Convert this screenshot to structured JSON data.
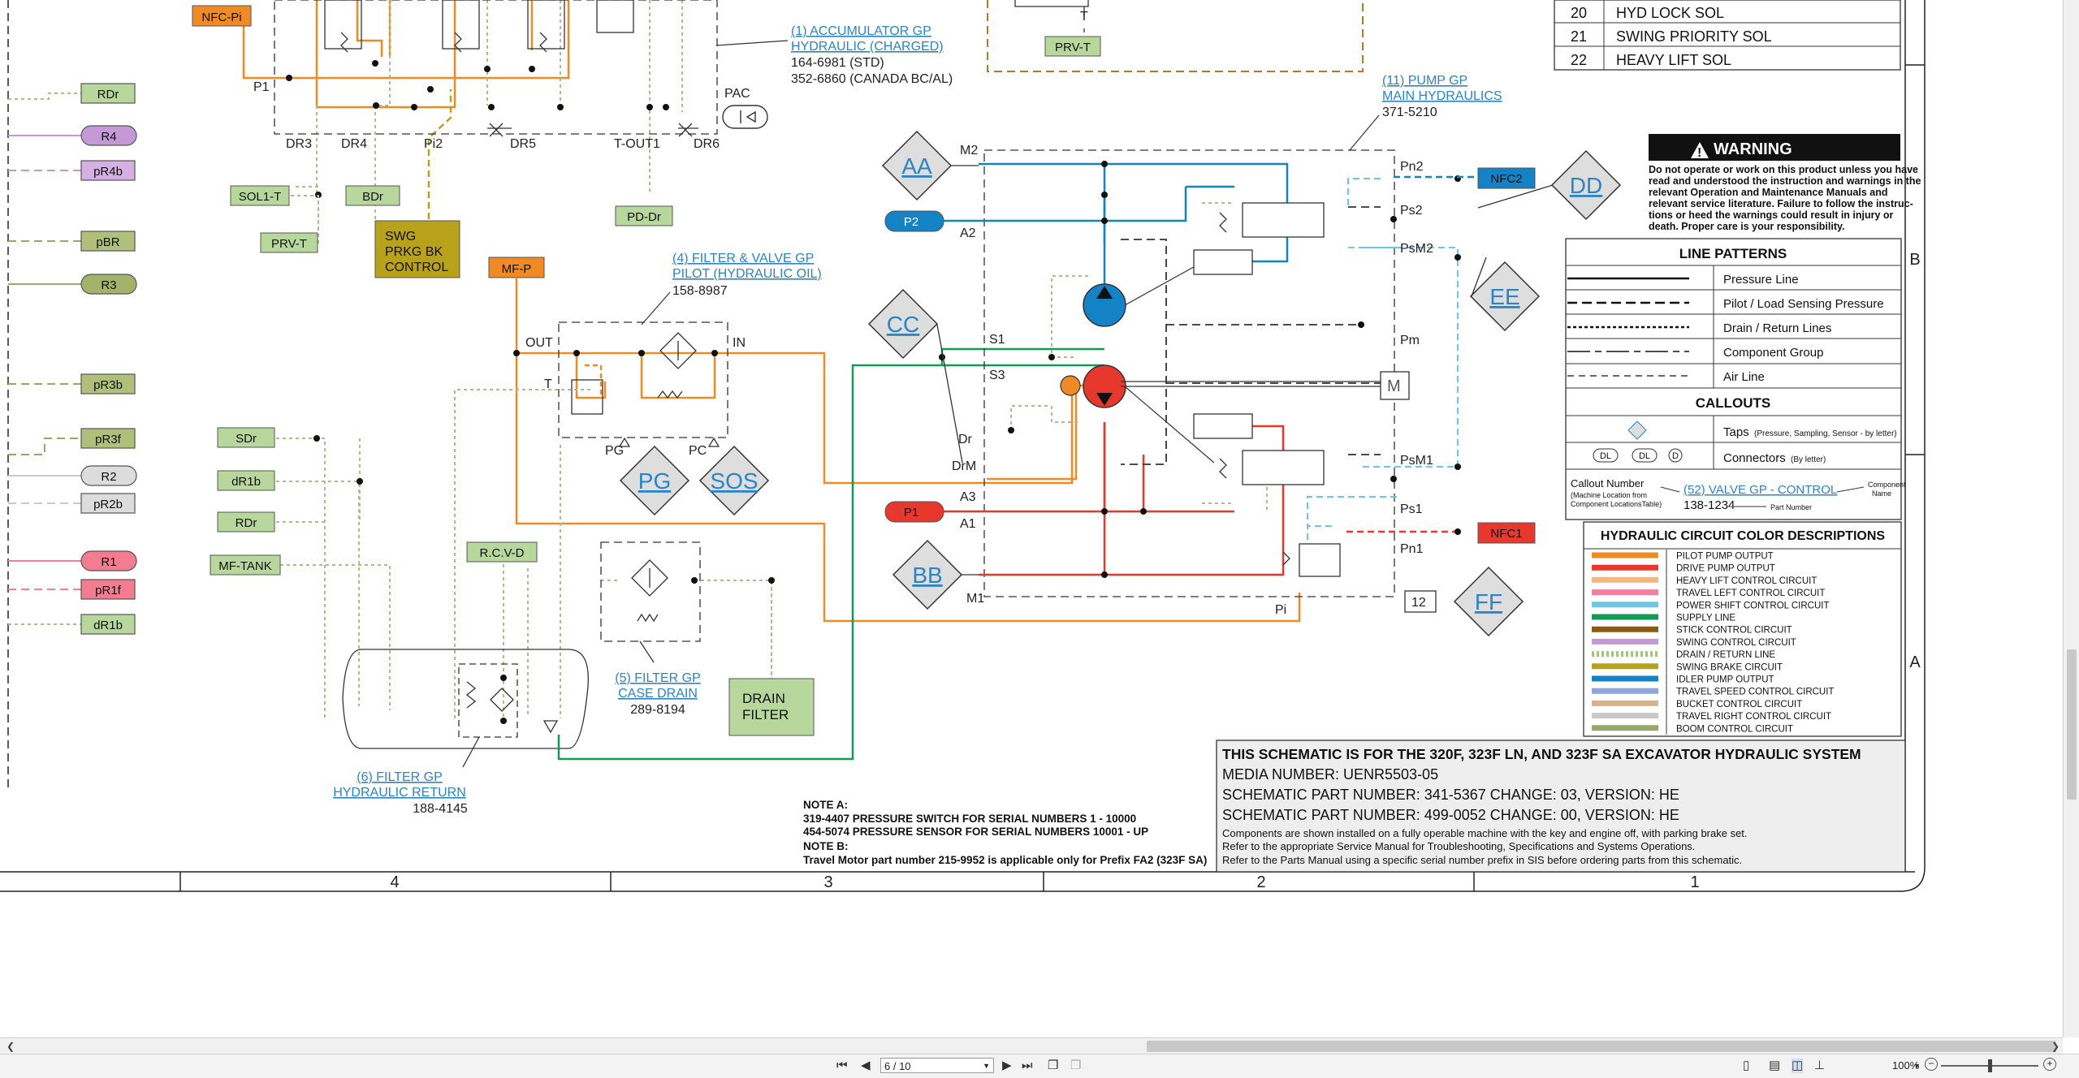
{
  "schematic": {
    "tags_left": [
      "RDr",
      "R4",
      "pR4b",
      "pBR",
      "R3",
      "pR3b",
      "pR3f",
      "R2",
      "pR2b",
      "R1",
      "pR1f",
      "dR1b"
    ],
    "tag_nfc_pi": "NFC-Pi",
    "tag_sol1t": "SOL1-T",
    "tag_bdr": "BDr",
    "tag_prvt": "PRV-T",
    "tag_prvt_top": "PRV-T",
    "tag_pddr": "PD-Dr",
    "tag_mfp": "MF-P",
    "tag_sdr": "SDr",
    "tag_dr1b": "dR1b",
    "tag_rdr2": "RDr",
    "tag_mftank": "MF-TANK",
    "tag_rcvd": "R.C.V-D",
    "tag_p2": "P2",
    "tag_p1": "P1",
    "tag_nfc2": "NFC2",
    "tag_nfc1": "NFC1",
    "swg_block": [
      "SWG",
      "PRKG BK",
      "CONTROL"
    ],
    "drain_filter": [
      "DRAIN",
      "FILTER"
    ],
    "valve_labels": [
      "P1",
      "DR3",
      "DR4",
      "Pi2",
      "DR5",
      "T-OUT1",
      "DR6",
      "PAC"
    ],
    "filter_labels": [
      "OUT",
      "IN",
      "T",
      "PG",
      "PC"
    ],
    "pump_labels": [
      "M2",
      "A2",
      "S1",
      "S3",
      "Dr",
      "DrM",
      "A3",
      "A1",
      "M1",
      "Pn2",
      "Ps2",
      "PsM2",
      "Pm",
      "PsM1",
      "Ps1",
      "Pn1",
      "Pi",
      "12"
    ],
    "diamonds": [
      "AA",
      "CC",
      "PG",
      "SOS",
      "BB",
      "DD",
      "EE",
      "FF"
    ],
    "callout_accum": [
      "(1) ACCUMULATOR GP",
      "HYDRAULIC (CHARGED)",
      "164-6981 (STD)",
      "352-6860 (CANADA BC/AL)"
    ],
    "callout_pump": [
      "(11) PUMP GP",
      "MAIN HYDRAULICS",
      "371-5210"
    ],
    "callout_filter4": [
      "(4) FILTER & VALVE GP",
      "PILOT (HYDRAULIC OIL)",
      "158-8987"
    ],
    "callout_filter5": [
      "(5) FILTER GP",
      "CASE DRAIN",
      "289-8194"
    ],
    "callout_filter6": [
      "(6) FILTER GP",
      "HYDRAULIC RETURN",
      "188-4145"
    ],
    "table_rows": [
      [
        "20",
        "HYD LOCK SOL"
      ],
      [
        "21",
        "SWING PRIORITY SOL"
      ],
      [
        "22",
        "HEAVY LIFT SOL"
      ]
    ],
    "warning_title": "WARNING",
    "warning_text": [
      "Do not operate or work on this product unless you have",
      "read and understood the instruction and warnings in the",
      "relevant Operation and Maintenance Manuals and",
      "relevant service literature. Failure to follow the instruc-",
      "tions or heed the warnings could result in injury or",
      "death. Proper care is your responsibility."
    ],
    "legend_title": "LINE PATTERNS",
    "legend_items": [
      "Pressure Line",
      "Pilot / Load Sensing Pressure",
      "Drain / Return Lines",
      "Component Group",
      "Air Line"
    ],
    "callouts_title": "CALLOUTS",
    "taps_label": "Taps",
    "taps_note": "(Pressure, Sampling, Sensor - by letter)",
    "connectors_label": "Connectors",
    "connectors_note": "(By letter)",
    "connector_glyphs": [
      "DL",
      "DL",
      "D"
    ],
    "callout_example": {
      "title": "Callout Number",
      "sub1": "(Machine Location from",
      "sub2": "Component LocationsTable)",
      "link": "(52) VALVE GP - CONTROL",
      "part": "138-1234",
      "component": "Component",
      "name": "Name",
      "part_number": "Part Number"
    },
    "color_title": "HYDRAULIC CIRCUIT COLOR DESCRIPTIONS",
    "colors": [
      {
        "color": "#f08a24",
        "label": "PILOT PUMP OUTPUT",
        "dotted": false
      },
      {
        "color": "#e8382e",
        "label": "DRIVE PUMP OUTPUT",
        "dotted": false
      },
      {
        "color": "#f7b77a",
        "label": "HEAVY LIFT CONTROL CIRCUIT",
        "dotted": false
      },
      {
        "color": "#f07fa0",
        "label": "TRAVEL LEFT CONTROL CIRCUIT",
        "dotted": false
      },
      {
        "color": "#6ec6e6",
        "label": "POWER SHIFT CONTROL CIRCUIT",
        "dotted": false
      },
      {
        "color": "#139a54",
        "label": "SUPPLY LINE",
        "dotted": false
      },
      {
        "color": "#8a5a14",
        "label": "STICK CONTROL CIRCUIT",
        "dotted": false
      },
      {
        "color": "#c49ad6",
        "label": "SWING CONTROL CIRCUIT",
        "dotted": false
      },
      {
        "color": "#a7c08a",
        "label": "DRAIN / RETURN LINE",
        "dotted": true
      },
      {
        "color": "#b8a21a",
        "label": "SWING BRAKE CIRCUIT",
        "dotted": false
      },
      {
        "color": "#1483c6",
        "label": "IDLER PUMP OUTPUT",
        "dotted": false
      },
      {
        "color": "#8ea6d8",
        "label": "TRAVEL  SPEED CONTROL CIRCUIT",
        "dotted": false
      },
      {
        "color": "#d8b38a",
        "label": "BUCKET CONTROL CIRCUIT",
        "dotted": false
      },
      {
        "color": "#c9c9c9",
        "label": "TRAVEL RIGHT CONTROL CIRCUIT",
        "dotted": false
      },
      {
        "color": "#98a86a",
        "label": "BOOM CONTROL CIRCUIT",
        "dotted": false
      }
    ],
    "title_block": [
      "THIS SCHEMATIC IS FOR THE 320F, 323F LN, AND 323F SA EXCAVATOR HYDRAULIC SYSTEM",
      "MEDIA NUMBER: UENR5503-05",
      "SCHEMATIC PART NUMBER: 341-5367 CHANGE: 03, VERSION: HE",
      "SCHEMATIC PART NUMBER: 499-0052 CHANGE: 00, VERSION: HE",
      "Components are shown installed on a fully operable machine with the key and engine off, with parking brake set.",
      "Refer to the appropriate Service Manual for Troubleshooting, Specifications and Systems Operations.",
      "Refer to the Parts Manual using a specific serial number prefix in SIS before ordering parts from this schematic."
    ],
    "notes": [
      "NOTE A:",
      "319-4407 PRESSURE SWITCH FOR SERIAL NUMBERS 1 - 10000",
      "454-5074 PRESSURE SENSOR FOR SERIAL NUMBERS 10001 - UP",
      "NOTE B:",
      "Travel Motor part number 215-9952 is applicable only for Prefix FA2 (323F SA)"
    ],
    "grid_bottom": [
      "4",
      "3",
      "2",
      "1"
    ],
    "grid_side": [
      "B",
      "A"
    ]
  },
  "toolbar": {
    "page_value": "6 / 10",
    "zoom": "100%"
  }
}
